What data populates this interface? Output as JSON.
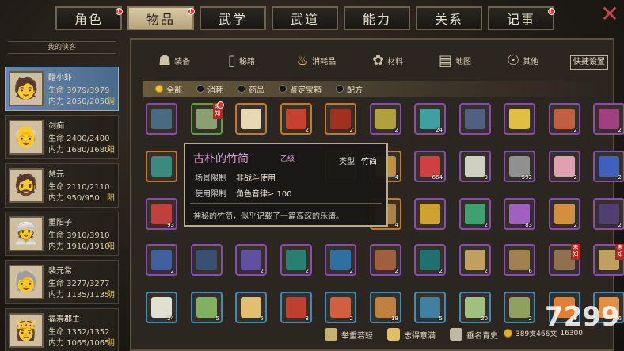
{
  "top_tabs": [
    {
      "label": "角色",
      "badge": true
    },
    {
      "label": "物品",
      "badge": true,
      "active": true
    },
    {
      "label": "武学",
      "badge": false
    },
    {
      "label": "武道",
      "badge": false
    },
    {
      "label": "能力",
      "badge": false
    },
    {
      "label": "关系",
      "badge": false
    },
    {
      "label": "记事",
      "badge": true
    }
  ],
  "sidebar": {
    "title": "我的侠客",
    "characters": [
      {
        "name": "醋小虾",
        "hp": "生命 3979/3979",
        "mp": "内力 2050/2050",
        "tag": "调"
      },
      {
        "name": "剑痴",
        "hp": "生命 2400/2400",
        "mp": "内力 1680/1680",
        "tag": "阳"
      },
      {
        "name": "慧元",
        "hp": "生命 2110/2110",
        "mp": "内力 950/950",
        "tag": "阳"
      },
      {
        "name": "重阳子",
        "hp": "生命 3910/3910",
        "mp": "内力 1910/1910",
        "tag": "阳"
      },
      {
        "name": "裴元常",
        "hp": "生命 3277/3277",
        "mp": "内力 1135/1135",
        "tag": "阴"
      },
      {
        "name": "福寿郡主",
        "hp": "生命 1352/1352",
        "mp": "内力 1065/1065",
        "tag": "阴"
      }
    ]
  },
  "sub_tabs": [
    {
      "label": "装备",
      "icon": "armor-icon"
    },
    {
      "label": "秘籍",
      "icon": "book-icon"
    },
    {
      "label": "消耗品",
      "icon": "potion-icon",
      "active": true
    },
    {
      "label": "材料",
      "icon": "herb-icon"
    },
    {
      "label": "地图",
      "icon": "map-icon"
    },
    {
      "label": "其他",
      "icon": "misc-icon"
    }
  ],
  "quick_button": "快捷设置",
  "filters": [
    {
      "label": "全部",
      "on": true
    },
    {
      "label": "消耗",
      "on": false
    },
    {
      "label": "药品",
      "on": false
    },
    {
      "label": "鉴定宝箱",
      "on": false
    },
    {
      "label": "配方",
      "on": false
    }
  ],
  "tooltip": {
    "title": "古朴的竹简",
    "grade": "乙级",
    "type_label": "类型",
    "type_value": "竹简",
    "scene_label": "场景限制",
    "scene_value": "非战斗使用",
    "use_label": "使用限制",
    "use_value": "角色音律≥ 100",
    "desc": "神秘的竹简，似乎记载了一篇高深的乐谱。"
  },
  "items": [
    {
      "color": "purple",
      "fill": "#4a6a80",
      "count": ""
    },
    {
      "color": "green",
      "fill": "#8aa070",
      "count": "",
      "newtag": "未知",
      "dot": true
    },
    {
      "color": "orange",
      "fill": "#e8d8b0",
      "count": ""
    },
    {
      "color": "orange",
      "fill": "#c84030",
      "count": "2"
    },
    {
      "color": "orange",
      "fill": "#a03020",
      "count": "2"
    },
    {
      "color": "purple",
      "fill": "#b0a040",
      "count": "2"
    },
    {
      "color": "purple",
      "fill": "#40a0a0",
      "count": "24"
    },
    {
      "color": "purple",
      "fill": "#506080",
      "count": ""
    },
    {
      "color": "purple",
      "fill": "#e0c040",
      "count": ""
    },
    {
      "color": "purple",
      "fill": "#c06040",
      "count": "2"
    },
    {
      "color": "purple",
      "fill": "#a04080",
      "count": "2"
    },
    {
      "color": "orange",
      "fill": "#3a8a80",
      "count": ""
    },
    {
      "color": "orange",
      "fill": "#5a4a30",
      "count": ""
    },
    {
      "color": "orange",
      "fill": "#c09040",
      "count": "4"
    },
    {
      "color": "purple",
      "fill": "#d04040",
      "count": "664"
    },
    {
      "color": "purple",
      "fill": "#d0d0c0",
      "count": "3"
    },
    {
      "color": "purple",
      "fill": "#909090",
      "count": "592"
    },
    {
      "color": "purple",
      "fill": "#e0a0b0",
      "count": "2"
    },
    {
      "color": "purple",
      "fill": "#4060c0",
      "count": "2"
    },
    {
      "color": "purple",
      "fill": "#c04040",
      "count": "93"
    },
    {
      "color": "orange",
      "fill": "#b08040",
      "count": "4"
    },
    {
      "color": "purple",
      "fill": "#d0a030",
      "count": ""
    },
    {
      "color": "purple",
      "fill": "#40a070",
      "count": "2"
    },
    {
      "color": "purple",
      "fill": "#a060c0",
      "count": "83"
    },
    {
      "color": "purple",
      "fill": "#d09040",
      "count": "2"
    },
    {
      "color": "purple",
      "fill": "#504070",
      "count": "2"
    },
    {
      "color": "purple",
      "fill": "#4060a0",
      "count": "2"
    },
    {
      "color": "purple",
      "fill": "#3a5070",
      "count": ""
    },
    {
      "color": "purple",
      "fill": "#6050a0",
      "count": "2"
    },
    {
      "color": "purple",
      "fill": "#2a8070",
      "count": "2"
    },
    {
      "color": "purple",
      "fill": "#3070a0",
      "count": "2"
    },
    {
      "color": "purple",
      "fill": "#a06040",
      "count": "2"
    },
    {
      "color": "purple",
      "fill": "#207070",
      "count": "2"
    },
    {
      "color": "purple",
      "fill": "#c0a060",
      "count": "2"
    },
    {
      "color": "purple",
      "fill": "#a08050",
      "count": "6"
    },
    {
      "color": "purple",
      "fill": "#907050",
      "count": "",
      "newtag": "未知"
    },
    {
      "color": "purple",
      "fill": "#c0a060",
      "count": "",
      "newtag": "未知"
    },
    {
      "color": "blue",
      "fill": "#e0e0d0",
      "count": "24"
    },
    {
      "color": "blue",
      "fill": "#80b060",
      "count": "5"
    },
    {
      "color": "blue",
      "fill": "#e0c070",
      "count": "5"
    },
    {
      "color": "blue",
      "fill": "#c04030",
      "count": "3"
    },
    {
      "color": "blue",
      "fill": "#d06040",
      "count": "2"
    },
    {
      "color": "blue",
      "fill": "#c08040",
      "count": "18"
    },
    {
      "color": "blue",
      "fill": "#4080a0",
      "count": "5"
    },
    {
      "color": "blue",
      "fill": "#a0c080",
      "count": "20"
    },
    {
      "color": "blue",
      "fill": "#90a060",
      "count": "2"
    },
    {
      "color": "blue",
      "fill": "#e08030",
      "count": "29"
    },
    {
      "color": "blue",
      "fill": "#e09040",
      "count": "6"
    }
  ],
  "bottom_bar": [
    {
      "label": "举重若轻",
      "icon": "weight-icon"
    },
    {
      "label": "志得意满",
      "icon": "face-icon"
    },
    {
      "label": "垂名青史",
      "icon": "scroll-icon"
    }
  ],
  "money": "389贯466文",
  "money2": "16300",
  "watermark": "7299"
}
